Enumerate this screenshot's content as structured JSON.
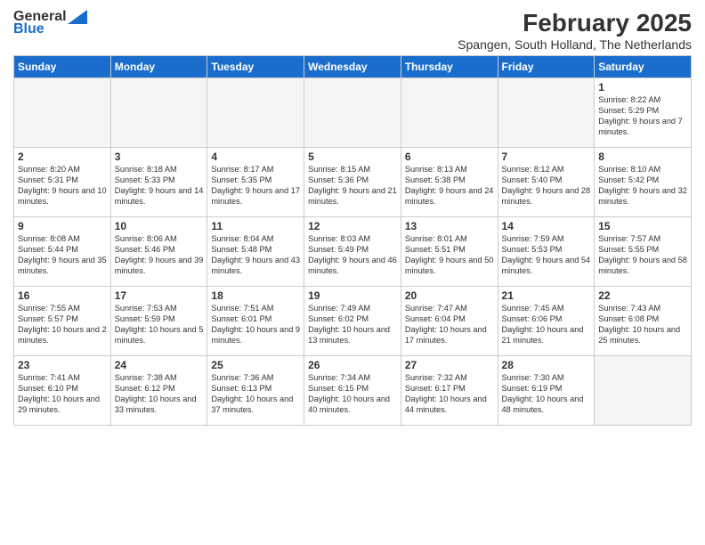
{
  "header": {
    "logo_general": "General",
    "logo_blue": "Blue",
    "title": "February 2025",
    "subtitle": "Spangen, South Holland, The Netherlands"
  },
  "weekdays": [
    "Sunday",
    "Monday",
    "Tuesday",
    "Wednesday",
    "Thursday",
    "Friday",
    "Saturday"
  ],
  "weeks": [
    [
      {
        "num": "",
        "info": ""
      },
      {
        "num": "",
        "info": ""
      },
      {
        "num": "",
        "info": ""
      },
      {
        "num": "",
        "info": ""
      },
      {
        "num": "",
        "info": ""
      },
      {
        "num": "",
        "info": ""
      },
      {
        "num": "1",
        "info": "Sunrise: 8:22 AM\nSunset: 5:29 PM\nDaylight: 9 hours and 7 minutes."
      }
    ],
    [
      {
        "num": "2",
        "info": "Sunrise: 8:20 AM\nSunset: 5:31 PM\nDaylight: 9 hours and 10 minutes."
      },
      {
        "num": "3",
        "info": "Sunrise: 8:18 AM\nSunset: 5:33 PM\nDaylight: 9 hours and 14 minutes."
      },
      {
        "num": "4",
        "info": "Sunrise: 8:17 AM\nSunset: 5:35 PM\nDaylight: 9 hours and 17 minutes."
      },
      {
        "num": "5",
        "info": "Sunrise: 8:15 AM\nSunset: 5:36 PM\nDaylight: 9 hours and 21 minutes."
      },
      {
        "num": "6",
        "info": "Sunrise: 8:13 AM\nSunset: 5:38 PM\nDaylight: 9 hours and 24 minutes."
      },
      {
        "num": "7",
        "info": "Sunrise: 8:12 AM\nSunset: 5:40 PM\nDaylight: 9 hours and 28 minutes."
      },
      {
        "num": "8",
        "info": "Sunrise: 8:10 AM\nSunset: 5:42 PM\nDaylight: 9 hours and 32 minutes."
      }
    ],
    [
      {
        "num": "9",
        "info": "Sunrise: 8:08 AM\nSunset: 5:44 PM\nDaylight: 9 hours and 35 minutes."
      },
      {
        "num": "10",
        "info": "Sunrise: 8:06 AM\nSunset: 5:46 PM\nDaylight: 9 hours and 39 minutes."
      },
      {
        "num": "11",
        "info": "Sunrise: 8:04 AM\nSunset: 5:48 PM\nDaylight: 9 hours and 43 minutes."
      },
      {
        "num": "12",
        "info": "Sunrise: 8:03 AM\nSunset: 5:49 PM\nDaylight: 9 hours and 46 minutes."
      },
      {
        "num": "13",
        "info": "Sunrise: 8:01 AM\nSunset: 5:51 PM\nDaylight: 9 hours and 50 minutes."
      },
      {
        "num": "14",
        "info": "Sunrise: 7:59 AM\nSunset: 5:53 PM\nDaylight: 9 hours and 54 minutes."
      },
      {
        "num": "15",
        "info": "Sunrise: 7:57 AM\nSunset: 5:55 PM\nDaylight: 9 hours and 58 minutes."
      }
    ],
    [
      {
        "num": "16",
        "info": "Sunrise: 7:55 AM\nSunset: 5:57 PM\nDaylight: 10 hours and 2 minutes."
      },
      {
        "num": "17",
        "info": "Sunrise: 7:53 AM\nSunset: 5:59 PM\nDaylight: 10 hours and 5 minutes."
      },
      {
        "num": "18",
        "info": "Sunrise: 7:51 AM\nSunset: 6:01 PM\nDaylight: 10 hours and 9 minutes."
      },
      {
        "num": "19",
        "info": "Sunrise: 7:49 AM\nSunset: 6:02 PM\nDaylight: 10 hours and 13 minutes."
      },
      {
        "num": "20",
        "info": "Sunrise: 7:47 AM\nSunset: 6:04 PM\nDaylight: 10 hours and 17 minutes."
      },
      {
        "num": "21",
        "info": "Sunrise: 7:45 AM\nSunset: 6:06 PM\nDaylight: 10 hours and 21 minutes."
      },
      {
        "num": "22",
        "info": "Sunrise: 7:43 AM\nSunset: 6:08 PM\nDaylight: 10 hours and 25 minutes."
      }
    ],
    [
      {
        "num": "23",
        "info": "Sunrise: 7:41 AM\nSunset: 6:10 PM\nDaylight: 10 hours and 29 minutes."
      },
      {
        "num": "24",
        "info": "Sunrise: 7:38 AM\nSunset: 6:12 PM\nDaylight: 10 hours and 33 minutes."
      },
      {
        "num": "25",
        "info": "Sunrise: 7:36 AM\nSunset: 6:13 PM\nDaylight: 10 hours and 37 minutes."
      },
      {
        "num": "26",
        "info": "Sunrise: 7:34 AM\nSunset: 6:15 PM\nDaylight: 10 hours and 40 minutes."
      },
      {
        "num": "27",
        "info": "Sunrise: 7:32 AM\nSunset: 6:17 PM\nDaylight: 10 hours and 44 minutes."
      },
      {
        "num": "28",
        "info": "Sunrise: 7:30 AM\nSunset: 6:19 PM\nDaylight: 10 hours and 48 minutes."
      },
      {
        "num": "",
        "info": ""
      }
    ]
  ]
}
